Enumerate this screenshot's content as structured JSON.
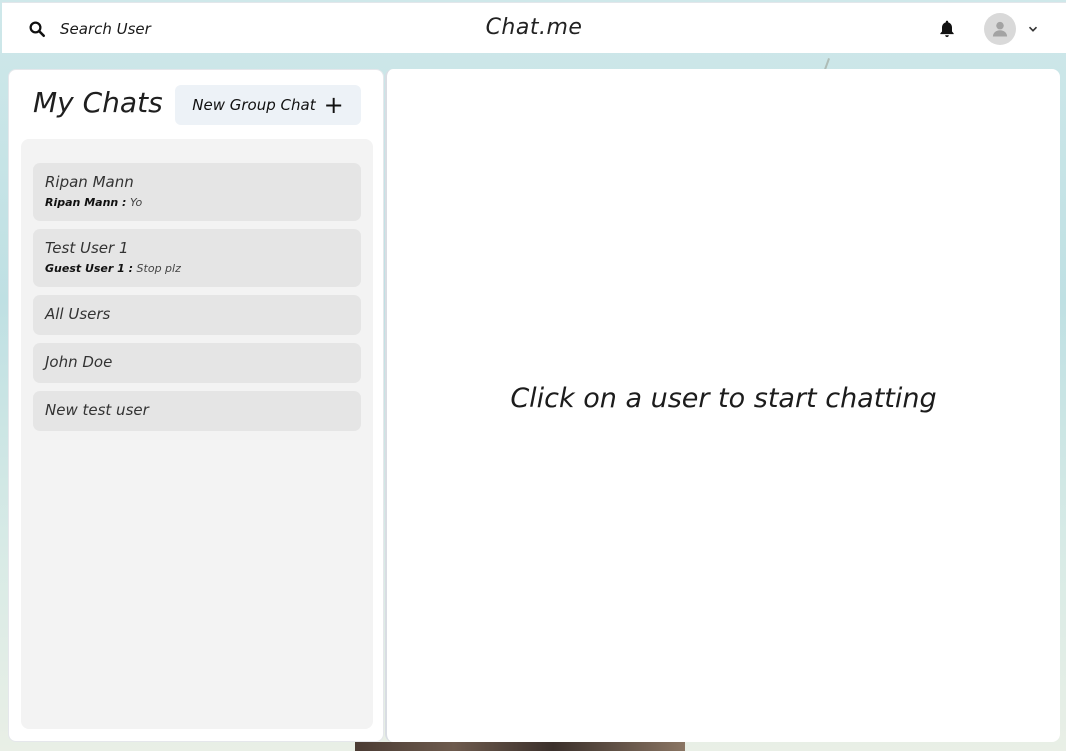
{
  "header": {
    "search_label": "Search User",
    "app_title": "Chat.me",
    "icons": {
      "search": "search-icon",
      "bell": "bell-icon",
      "avatar": "user-avatar-icon",
      "chevron": "chevron-down-icon"
    }
  },
  "sidebar": {
    "title": "My Chats",
    "new_group_label": "New Group Chat",
    "chats": [
      {
        "name": "Ripan Mann",
        "sender": "Ripan Mann :",
        "message": "Yo"
      },
      {
        "name": "Test User 1",
        "sender": "Guest User 1 :",
        "message": "Stop plz"
      },
      {
        "name": "All Users"
      },
      {
        "name": "John Doe"
      },
      {
        "name": "New test user"
      }
    ]
  },
  "main": {
    "empty_message": "Click on a user to start chatting"
  },
  "colors": {
    "chat_item_bg": "#e5e5e5",
    "chat_list_bg": "#f3f3f3",
    "button_bg": "#edf2f7"
  }
}
